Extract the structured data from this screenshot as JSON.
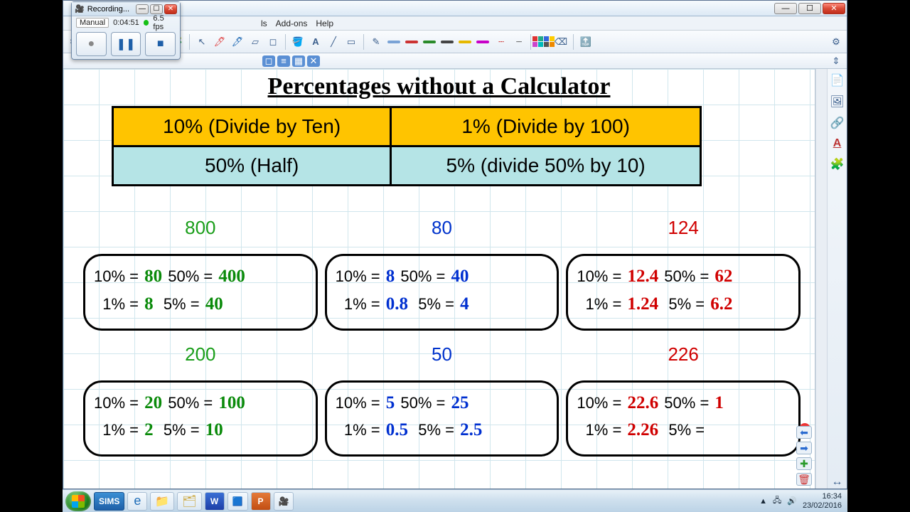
{
  "window": {
    "min": "—",
    "max": "☐",
    "close": "✕"
  },
  "menubar": {
    "items": [
      "ls",
      "Add-ons",
      "Help"
    ]
  },
  "toolbar": {
    "gear": "⚙",
    "collapse": "⇕"
  },
  "recorder": {
    "title": "Recording...",
    "mode": "Manual",
    "time": "0:04:51",
    "fps": "6.5 fps",
    "btn_record": "●",
    "btn_pause": "❚❚",
    "btn_stop": "■"
  },
  "page": {
    "title": "Percentages without a Calculator",
    "rules": {
      "r10": "10% (Divide by Ten)",
      "r1": "1% (Divide by 100)",
      "r50": "50% (Half)",
      "r5": "5% (divide 50% by 10)"
    },
    "labels": {
      "p10": "10% = ",
      "p50": " 50% = ",
      "p1": "  1% = ",
      "p5": "  5% = "
    },
    "examples": [
      {
        "head": "800",
        "color": "green",
        "v10": "80",
        "v50": "400",
        "v1": "8",
        "v5": "40"
      },
      {
        "head": "80",
        "color": "blue",
        "v10": "8",
        "v50": "40",
        "v1": "0.8",
        "v5": "4"
      },
      {
        "head": "124",
        "color": "red",
        "v10": "12.4",
        "v50": "62",
        "v1": "1.24",
        "v5": "6.2"
      },
      {
        "head": "200",
        "color": "green",
        "v10": "20",
        "v50": "100",
        "v1": "2",
        "v5": "10"
      },
      {
        "head": "50",
        "color": "blue",
        "v10": "5",
        "v50": "25",
        "v1": "0.5",
        "v5": "2.5"
      },
      {
        "head": "226",
        "color": "red",
        "v10": "22.6",
        "v50": "1",
        "v1": "2.26",
        "v5": ""
      }
    ]
  },
  "side": {
    "icons": [
      "📄",
      "🖼",
      "🔗",
      "A",
      "🧩"
    ]
  },
  "pagenav": {
    "prev": "⬅",
    "next": "➡",
    "add": "✚",
    "del": "🗑"
  },
  "taskbar": {
    "sims": "SIMS",
    "word": "W",
    "ppt": "P",
    "time": "16:34",
    "date": "23/02/2016"
  }
}
